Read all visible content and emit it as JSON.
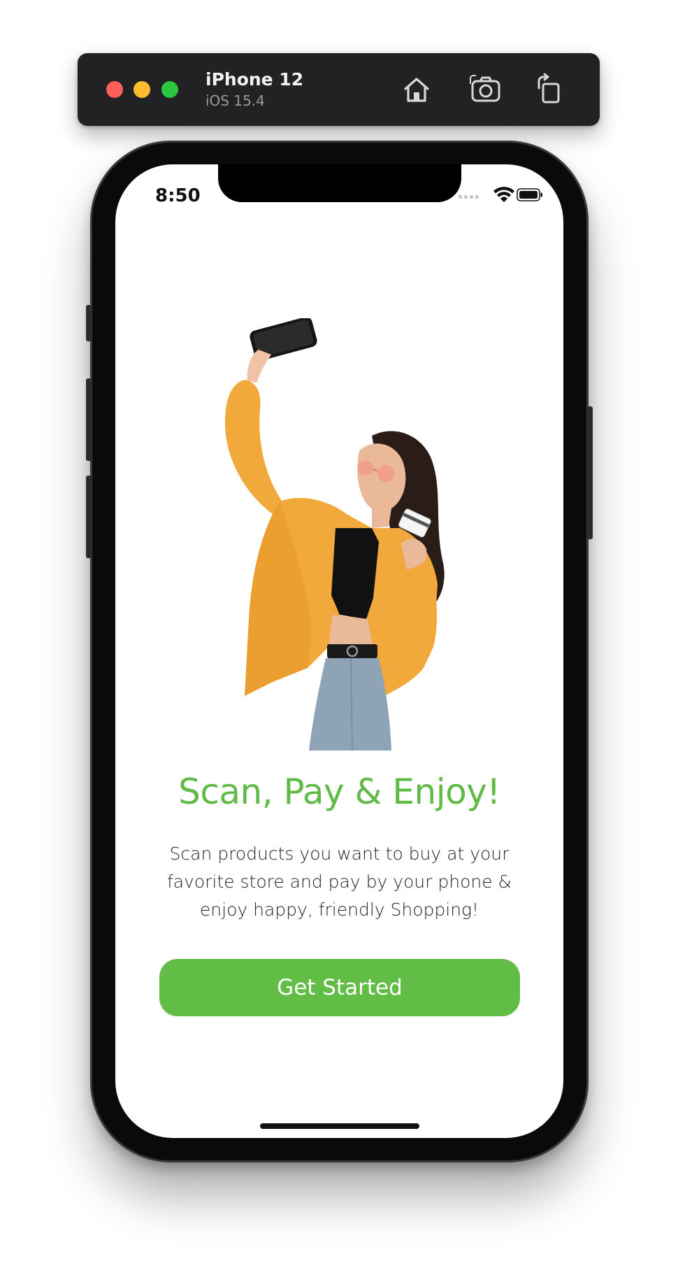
{
  "simulator": {
    "device_name": "iPhone 12",
    "os_version": "iOS 15.4",
    "controls": {
      "traffic_lights": [
        "close",
        "minimize",
        "zoom"
      ],
      "icons": [
        "home-icon",
        "screenshot-icon",
        "rotate-icon"
      ]
    }
  },
  "status_bar": {
    "time": "8:50",
    "icons": [
      "signal-icon",
      "wifi-icon",
      "battery-icon"
    ]
  },
  "onboarding": {
    "hero_image": "woman-holding-phone-and-card",
    "title": "Scan, Pay & Enjoy!",
    "description": "Scan products you want to buy at your favorite store and pay by your phone & enjoy happy, friendly Shopping!",
    "cta_label": "Get Started"
  },
  "colors": {
    "accent": "#62bd47",
    "title": "#5fba46",
    "toolbar_bg": "#222224",
    "jacket": "#f2a93b"
  }
}
